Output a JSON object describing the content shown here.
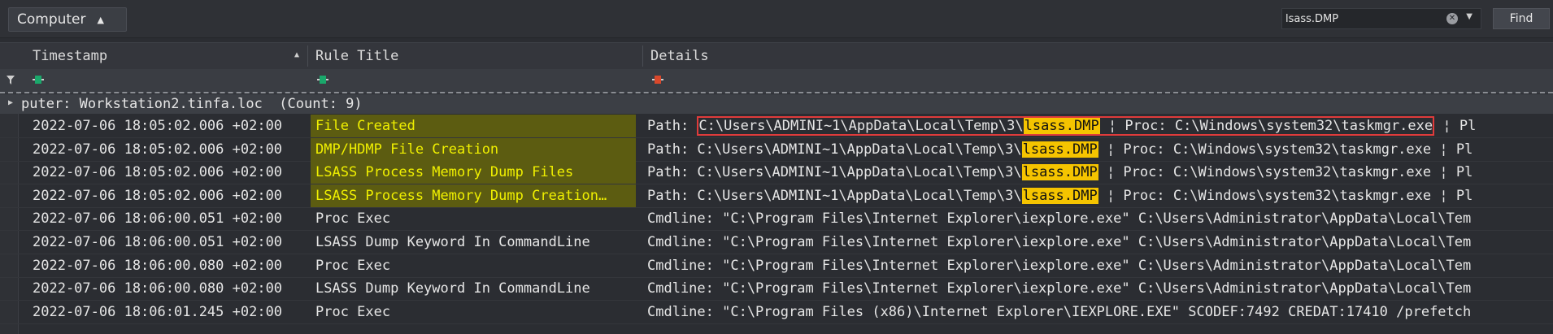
{
  "toolbar": {
    "group_label": "Computer",
    "search_value": "lsass.DMP",
    "find_label": "Find"
  },
  "columns": {
    "timestamp": "Timestamp",
    "rule_title": "Rule Title",
    "details": "Details"
  },
  "group_row": "puter: Workstation2.tinfa.loc  (Count: 9)",
  "rows": [
    {
      "timestamp": "2022-07-06 18:05:02.006 +02:00",
      "rule": "File Created",
      "d1": "Path: ",
      "d2": "C:\\Users\\ADMINI~1\\AppData\\Local\\Temp\\3\\",
      "d3": "lsass.DMP",
      "d4": " ¦ Proc: C:\\Windows\\system32\\taskmgr.exe",
      "d5": " ¦ Pl"
    },
    {
      "timestamp": "2022-07-06 18:05:02.006 +02:00",
      "rule": "DMP/HDMP File Creation",
      "d1": "Path: ",
      "d2": "C:\\Users\\ADMINI~1\\AppData\\Local\\Temp\\3\\",
      "d3": "lsass.DMP",
      "d4": " ¦ Proc: C:\\Windows\\system32\\taskmgr.exe",
      "d5": " ¦ Pl"
    },
    {
      "timestamp": "2022-07-06 18:05:02.006 +02:00",
      "rule": "LSASS Process Memory Dump Files",
      "d1": "Path: ",
      "d2": "C:\\Users\\ADMINI~1\\AppData\\Local\\Temp\\3\\",
      "d3": "lsass.DMP",
      "d4": " ¦ Proc: C:\\Windows\\system32\\taskmgr.exe",
      "d5": " ¦ Pl"
    },
    {
      "timestamp": "2022-07-06 18:05:02.006 +02:00",
      "rule": "LSASS Process Memory Dump Creation…",
      "d1": "Path: ",
      "d2": "C:\\Users\\ADMINI~1\\AppData\\Local\\Temp\\3\\",
      "d3": "lsass.DMP",
      "d4": " ¦ Proc: C:\\Windows\\system32\\taskmgr.exe",
      "d5": " ¦ Pl"
    },
    {
      "timestamp": "2022-07-06 18:06:00.051 +02:00",
      "rule": "Proc Exec",
      "details": "Cmdline: \"C:\\Program Files\\Internet Explorer\\iexplore.exe\" C:\\Users\\Administrator\\AppData\\Local\\Tem"
    },
    {
      "timestamp": "2022-07-06 18:06:00.051 +02:00",
      "rule": "LSASS Dump Keyword In CommandLine",
      "details": "Cmdline: \"C:\\Program Files\\Internet Explorer\\iexplore.exe\" C:\\Users\\Administrator\\AppData\\Local\\Tem"
    },
    {
      "timestamp": "2022-07-06 18:06:00.080 +02:00",
      "rule": "Proc Exec",
      "details": "Cmdline: \"C:\\Program Files\\Internet Explorer\\iexplore.exe\" C:\\Users\\Administrator\\AppData\\Local\\Tem"
    },
    {
      "timestamp": "2022-07-06 18:06:00.080 +02:00",
      "rule": "LSASS Dump Keyword In CommandLine",
      "details": "Cmdline: \"C:\\Program Files\\Internet Explorer\\iexplore.exe\" C:\\Users\\Administrator\\AppData\\Local\\Tem"
    },
    {
      "timestamp": "2022-07-06 18:06:01.245 +02:00",
      "rule": "Proc Exec",
      "details": "Cmdline: \"C:\\Program Files (x86)\\Internet Explorer\\IEXPLORE.EXE\" SCODEF:7492 CREDAT:17410 /prefetch"
    }
  ]
}
